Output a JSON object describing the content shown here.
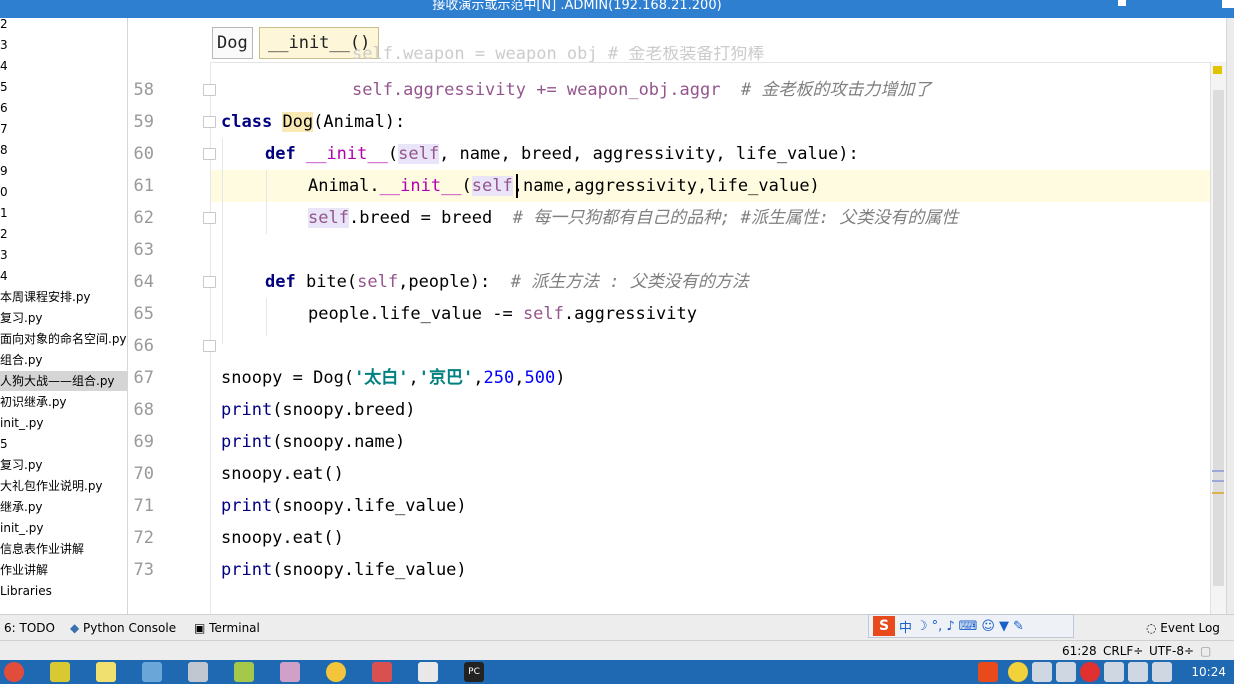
{
  "window": {
    "title": "接收演示或示范中[N] .ADMIN(192.168.21.200)"
  },
  "project_panel": {
    "items": [
      "2",
      "3",
      "4",
      "5",
      "6",
      "7",
      "8",
      "9",
      "0",
      "1",
      "2",
      "3",
      "4",
      "本周课程安排.py",
      "复习.py",
      "面向对象的命名空间.py",
      "组合.py",
      "人狗大战——组合.py",
      "初识继承.py",
      "init_.py",
      "5",
      "复习.py",
      "大礼包作业说明.py",
      "继承.py",
      "init_.py",
      "信息表作业讲解",
      "作业讲解",
      "Libraries"
    ],
    "selected_index": 17
  },
  "breadcrumb": {
    "class_name": "Dog",
    "method_name": "__init__()"
  },
  "editor": {
    "line_numbers": [
      "58",
      "59",
      "60",
      "61",
      "62",
      "63",
      "64",
      "65",
      "66",
      "67",
      "68",
      "69",
      "70",
      "71",
      "72",
      "73"
    ],
    "line_57_partial": "self.weapon = weapon_obj # 金老板装备打狗棒",
    "line_58": {
      "code": "self.aggressivity += weapon_obj.aggr",
      "comment": "# 金老板的攻击力增加了"
    },
    "line_59": {
      "kw": "class",
      "name": "Dog",
      "rest": "(Animal):"
    },
    "line_60": {
      "kw": "def",
      "name": "__init__",
      "open": "(",
      "self": "self",
      "params": ", name, breed, aggressivity, life_value):"
    },
    "line_61": {
      "pre": "Animal.",
      "call": "__init__",
      "open": "(",
      "self": "self",
      "params": ",name,aggressivity,life_value)"
    },
    "line_62": {
      "self": "self",
      "code": ".breed = breed",
      "comment": "# 每一只狗都有自己的品种; #派生属性: 父类没有的属性"
    },
    "line_64": {
      "kw": "def",
      "name": " bite(",
      "self": "self",
      "params": ",people):",
      "comment": "# 派生方法 : 父类没有的方法"
    },
    "line_65": {
      "code": "people.life_value -= ",
      "self": "self",
      "rest": ".aggressivity"
    },
    "line_67": {
      "pre": "snoopy = Dog(",
      "s1": "'太白'",
      "c1": ",",
      "s2": "'京巴'",
      "c2": ",",
      "n1": "250",
      "c3": ",",
      "n2": "500",
      "end": ")"
    },
    "line_68": {
      "fn": "print",
      "rest": "(snoopy.breed)"
    },
    "line_69": {
      "fn": "print",
      "rest": "(snoopy.name)"
    },
    "line_70": {
      "code": "snoopy.eat()"
    },
    "line_71": {
      "fn": "print",
      "rest": "(snoopy.life_value)"
    },
    "line_72": {
      "code": "snoopy.eat()"
    },
    "line_73": {
      "fn": "print",
      "rest": "(snoopy.life_value)"
    }
  },
  "tool_windows": {
    "todo": "6: TODO",
    "python_console": "Python Console",
    "terminal": "Terminal",
    "event_log": "Event Log"
  },
  "ime_bar": {
    "logo": "S",
    "mode": "中"
  },
  "status_bar": {
    "position": "61:28",
    "line_sep": "CRLF÷",
    "encoding": "UTF-8÷"
  },
  "taskbar": {
    "time": "10:24"
  },
  "colors": {
    "keyword": "#000080",
    "self": "#94558d",
    "string": "#008080",
    "number": "#0000ff",
    "comment": "#808080",
    "taskbar": "#1f69b3"
  }
}
